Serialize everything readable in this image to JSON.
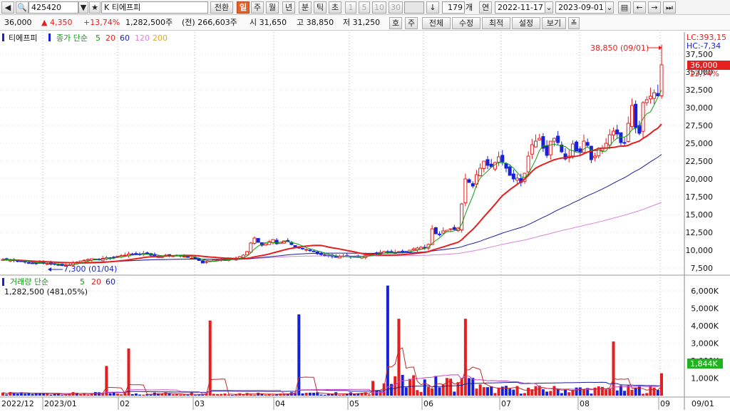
{
  "toolbar": {
    "code": "425420",
    "name": "K 티에프피",
    "convert_label": "전환",
    "periods": [
      "일",
      "주",
      "월",
      "년",
      "분",
      "틱",
      "초"
    ],
    "selected_period": "일",
    "minute_options": [
      "1",
      "5",
      "10",
      "30"
    ],
    "count": "179",
    "count_unit": "개",
    "year_label": "연",
    "start_date": "2022-11-17",
    "end_date": "2023-09-01"
  },
  "quote": {
    "price": "36,000",
    "change": "▲ 4,350",
    "change_pct": "+13,74%",
    "volume": "1,282,500주",
    "prev_volume": "(전) 266,603주",
    "open": "시 31,650",
    "high": "고 38,850",
    "low": "저 31,250",
    "buttons": [
      "호",
      "주",
      "전체",
      "수정",
      "최적",
      "설정",
      "보기"
    ]
  },
  "legend": {
    "name": "티에프피",
    "type": "종가 단순",
    "ma_periods": [
      "5",
      "20",
      "60",
      "120",
      "200"
    ],
    "volume_title": "거래량 단순",
    "volume_ma": [
      "5",
      "20",
      "60"
    ],
    "volume_value": "1,282,500 (481,05%)"
  },
  "annotations": {
    "max_label": "38,850 (09/01)",
    "min_label": "7,300 (01/04)",
    "lc": "LC:393,15",
    "hc": "HC:-7,34",
    "current_price": "36,000",
    "current_pct": "13,74%",
    "current_volume": "1,844K"
  },
  "colors": {
    "up": "#e31f1f",
    "down": "#1621d8",
    "ma5": "#129a12",
    "ma20": "#e31f1f",
    "ma60": "#1a1f9e",
    "ma120": "#d983d9",
    "vma20": "#c22a2a",
    "vma60": "#cc44cc"
  },
  "chart_data": {
    "type": "candlestick",
    "price_axis": [
      "37,500",
      "35,000",
      "32,500",
      "30,000",
      "27,500",
      "25,000",
      "22,500",
      "20,000",
      "17,500",
      "15,000",
      "12,500",
      "10,000",
      "7,500"
    ],
    "volume_axis": [
      "6,000K",
      "5,000K",
      "4,000K",
      "3,000K",
      "2,000K",
      "1,000K"
    ],
    "x_labels": [
      "2022/12",
      "2023/01",
      "02",
      "03",
      "04",
      "05",
      "06",
      "07",
      "08",
      "09",
      "09/01"
    ],
    "closes": [
      8700,
      8600,
      8650,
      8550,
      8500,
      8400,
      8350,
      8250,
      8200,
      8150,
      8250,
      8150,
      8100,
      8050,
      8000,
      7950,
      7850,
      7900,
      7950,
      8250,
      8300,
      8500,
      8600,
      8700,
      8800,
      8750,
      8650,
      8850,
      8950,
      8900,
      9000,
      9150,
      9250,
      9300,
      9450,
      9400,
      9350,
      9400,
      9550,
      9500,
      9300,
      9100,
      9050,
      9200,
      9300,
      9250,
      9200,
      9300,
      9250,
      9150,
      9000,
      8900,
      8800,
      8550,
      8200,
      8400,
      8500,
      8600,
      8650,
      8700,
      8650,
      8700,
      8750,
      8900,
      9100,
      9300,
      9800,
      11000,
      11700,
      11100,
      10700,
      10900,
      11200,
      11500,
      10900,
      11100,
      11300,
      11200,
      10800,
      10400,
      10300,
      10200,
      10100,
      10000,
      9800,
      9500,
      9400,
      9300,
      9200,
      9100,
      9000,
      9100,
      9200,
      9100,
      9050,
      9100,
      9000,
      9100,
      9300,
      9400,
      9500,
      9600,
      9700,
      9800,
      9700,
      9600,
      9700,
      9800,
      9700,
      9800,
      10000,
      10200,
      10300,
      10400,
      10300,
      10800,
      13000,
      12300,
      12200,
      12700,
      12800,
      13000,
      12900,
      13100,
      16500,
      20000,
      19500,
      19000,
      20600,
      21500,
      22500,
      21900,
      21700,
      22300,
      23100,
      22400,
      21500,
      20500,
      20000,
      20100,
      19500,
      20800,
      23200,
      24800,
      25300,
      25700,
      24300,
      23300,
      25300,
      25700,
      25100,
      23800,
      22800,
      23200,
      24900,
      23900,
      23700,
      25300,
      24700,
      22700,
      23200,
      24300,
      24300,
      25000,
      26200,
      26700,
      26300,
      25100,
      25100,
      27800,
      30300,
      27200,
      26400,
      30700,
      31100,
      31600,
      32100,
      31650,
      36000
    ],
    "max_price": 38850,
    "min_price": 7300,
    "volume_highlights": [
      {
        "date": "2023/02 mid",
        "volume_k": 1700
      },
      {
        "date": "2023/02 late",
        "volume_k": 2700
      },
      {
        "date": "2023/03 late",
        "volume_k": 4300
      },
      {
        "date": "2023/05 mid",
        "volume_k": 4650
      },
      {
        "date": "2023/06 late",
        "volume_k": 6300
      },
      {
        "date": "2023/07 early",
        "volume_k": 4400
      },
      {
        "date": "2023/08 late",
        "volume_k": 3100
      },
      {
        "date": "2023/09/01",
        "volume_k": 1282.5
      }
    ]
  }
}
